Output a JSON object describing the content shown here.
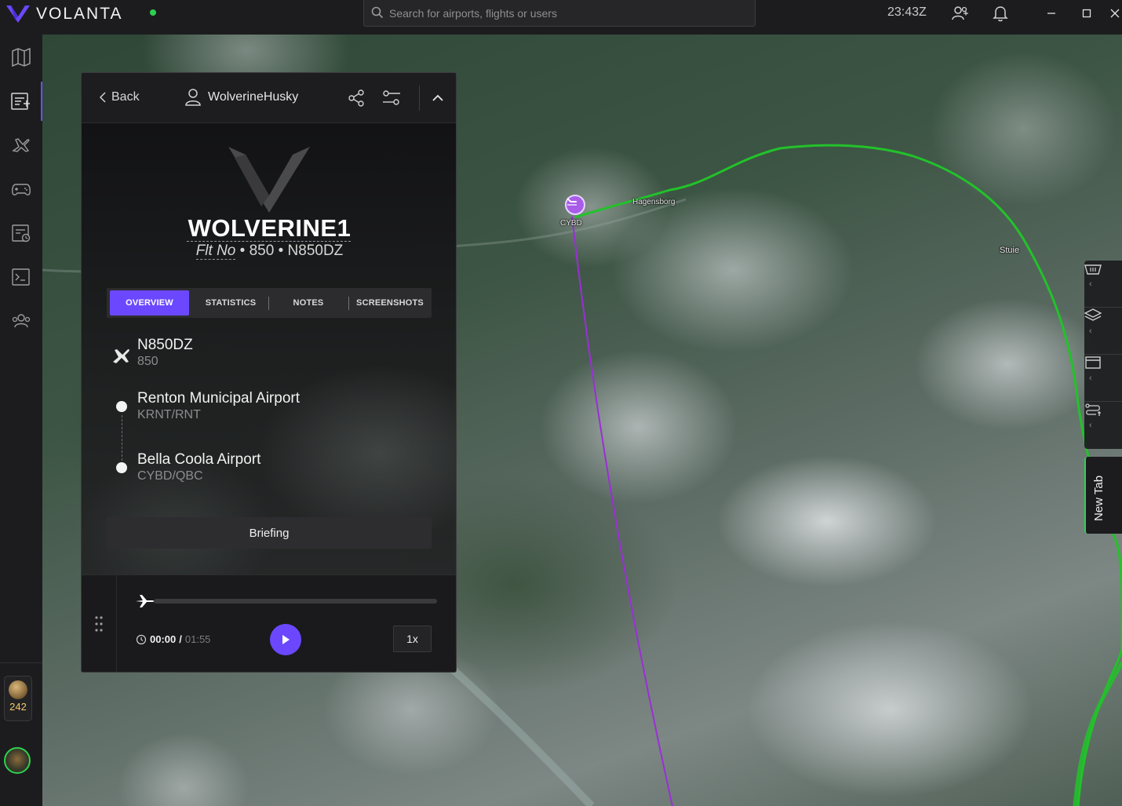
{
  "app": {
    "brand": "VOLANTA",
    "status_color": "#2ed14f",
    "accent_color": "#6b48ff",
    "clock": "23:43Z",
    "search_placeholder": "Search for airports, flights or users"
  },
  "rail": {
    "items": [
      "map-icon",
      "flight-plan-icon",
      "flights-icon",
      "gamepad-icon",
      "logbook-icon",
      "terminal-icon",
      "community-icon"
    ],
    "active_index": 1,
    "points": "242"
  },
  "map": {
    "labels": {
      "airport_code": "CYBD",
      "town_1": "Hagensborg",
      "town_2": "Stuie"
    },
    "route_color": "#22c22a",
    "track_color": "#9b2fd6"
  },
  "map_tools": {
    "items": [
      "basket-icon",
      "layers-icon",
      "window-icon",
      "route-icon"
    ],
    "new_tab_label": "New Tab"
  },
  "panel": {
    "back_label": "Back",
    "pilot_name": "WolverineHusky",
    "callsign": "WOLVERINE1",
    "subline": {
      "flt_no_label": "Flt No",
      "flight_number": "850",
      "registration": "N850DZ",
      "separator": "•"
    },
    "tabs": [
      "OVERVIEW",
      "STATISTICS",
      "NOTES",
      "SCREENSHOTS"
    ],
    "active_tab": 0,
    "aircraft": {
      "registration": "N850DZ",
      "flight_number": "850"
    },
    "departure": {
      "name": "Renton Municipal Airport",
      "codes": "KRNT/RNT"
    },
    "arrival": {
      "name": "Bella Coola Airport",
      "codes": "CYBD/QBC"
    },
    "briefing_label": "Briefing"
  },
  "player": {
    "current_time": "00:00",
    "slash": "/",
    "total_time": "01:55",
    "progress": 0,
    "speed": "1x"
  }
}
